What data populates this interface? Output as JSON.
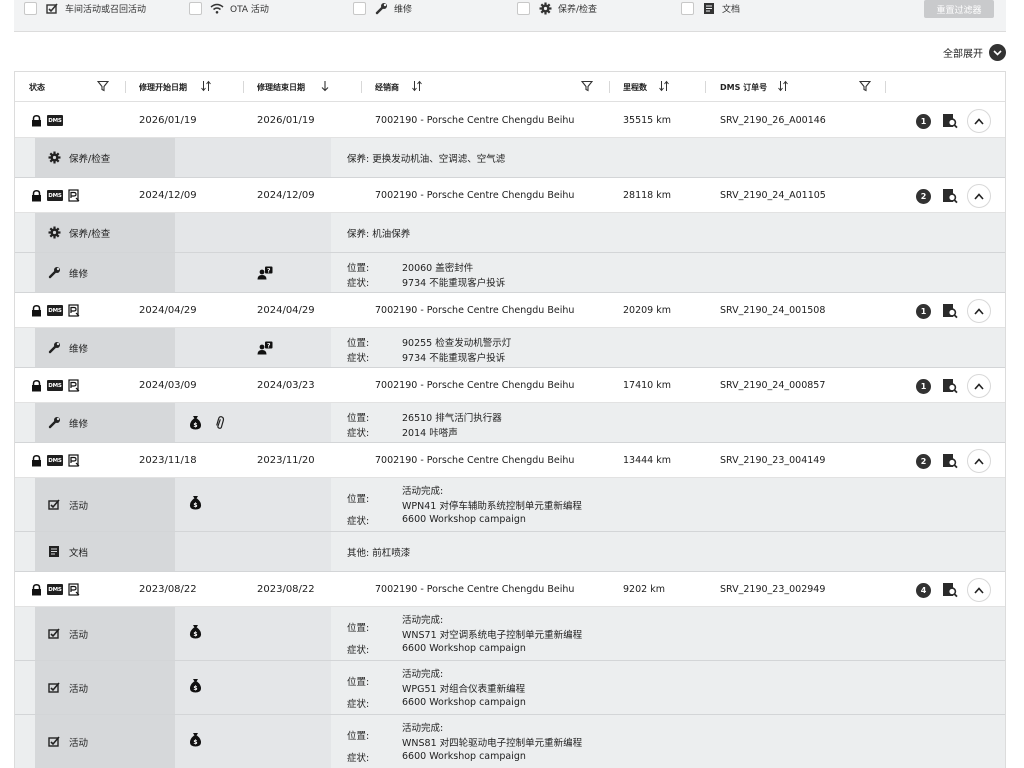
{
  "filters": [
    {
      "label": "车间活动或召回活动",
      "icon": "campaign-icon"
    },
    {
      "label": "OTA 活动",
      "icon": "wifi-icon"
    },
    {
      "label": "维修",
      "icon": "wrench-icon"
    },
    {
      "label": "保养/检查",
      "icon": "gear-icon"
    },
    {
      "label": "文档",
      "icon": "document-icon"
    }
  ],
  "reset_label": "重置过滤器",
  "expand_all_label": "全部展开",
  "columns": {
    "status": "状态",
    "start": "修理开始日期",
    "end": "修理结束日期",
    "dealer": "经销商",
    "mileage": "里程数",
    "dms_order": "DMS 订单号"
  },
  "records": [
    {
      "start": "2026/01/19",
      "end": "2026/01/19",
      "dealer": "7002190 - Porsche Centre Chengdu Beihu",
      "mileage": "35515 km",
      "order": "SRV_2190_26_A00146",
      "count": "1",
      "subs": [
        {
          "type": "保养/检查",
          "text": "保养: 更换发动机油、空调滤、空气滤"
        }
      ]
    },
    {
      "start": "2024/12/09",
      "end": "2024/12/09",
      "dealer": "7002190 - Porsche Centre Chengdu Beihu",
      "mileage": "28118 km",
      "order": "SRV_2190_24_A01105",
      "count": "2",
      "subs": [
        {
          "type": "保养/检查",
          "text": "保养: 机油保养"
        },
        {
          "type": "维修",
          "k1": "位置:",
          "v1": "20060 盖密封件",
          "k2": "症状:",
          "v2": "9734 不能重现客户投诉"
        }
      ]
    },
    {
      "start": "2024/04/29",
      "end": "2024/04/29",
      "dealer": "7002190 - Porsche Centre Chengdu Beihu",
      "mileage": "20209 km",
      "order": "SRV_2190_24_001508",
      "count": "1",
      "subs": [
        {
          "type": "维修",
          "k1": "位置:",
          "v1": "90255 检查发动机警示灯",
          "k2": "症状:",
          "v2": "9734 不能重现客户投诉"
        }
      ]
    },
    {
      "start": "2024/03/09",
      "end": "2024/03/23",
      "dealer": "7002190 - Porsche Centre Chengdu Beihu",
      "mileage": "17410 km",
      "order": "SRV_2190_24_000857",
      "count": "1",
      "subs": [
        {
          "type": "维修",
          "k1": "位置:",
          "v1": "26510 排气活门执行器",
          "k2": "症状:",
          "v2": "2014 咔嗒声"
        }
      ]
    },
    {
      "start": "2023/11/18",
      "end": "2023/11/20",
      "dealer": "7002190 - Porsche Centre Chengdu Beihu",
      "mileage": "13444 km",
      "order": "SRV_2190_23_004149",
      "count": "2",
      "subs": [
        {
          "type": "活动",
          "l0": "活动完成:",
          "k1": "位置:",
          "v1": "WPN41 对停车辅助系统控制单元重新编程",
          "k2": "症状:",
          "v2": "6600 Workshop campaign"
        },
        {
          "type": "文档",
          "text": "其他: 前杠喷漆"
        }
      ]
    },
    {
      "start": "2023/08/22",
      "end": "2023/08/22",
      "dealer": "7002190 - Porsche Centre Chengdu Beihu",
      "mileage": "9202 km",
      "order": "SRV_2190_23_002949",
      "count": "4",
      "subs": [
        {
          "type": "活动",
          "l0": "活动完成:",
          "k1": "位置:",
          "v1": "WNS71 对空调系统电子控制单元重新编程",
          "k2": "症状:",
          "v2": "6600 Workshop campaign"
        },
        {
          "type": "活动",
          "l0": "活动完成:",
          "k1": "位置:",
          "v1": "WPG51 对组合仪表重新编程",
          "k2": "症状:",
          "v2": "6600 Workshop campaign"
        },
        {
          "type": "活动",
          "l0": "活动完成:",
          "k1": "位置:",
          "v1": "WNS81 对四轮驱动电子控制单元重新编程",
          "k2": "症状:",
          "v2": "6600 Workshop campaign"
        }
      ]
    }
  ],
  "dms_badge": "DMS"
}
